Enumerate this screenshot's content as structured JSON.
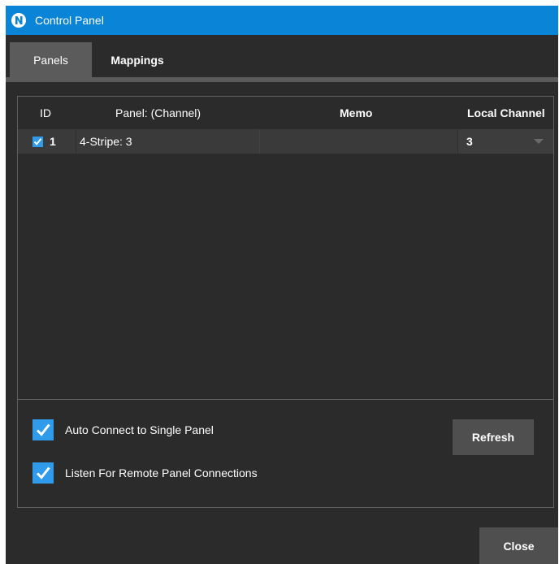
{
  "window": {
    "title": "Control Panel",
    "titlebar_color": "#0a84d6",
    "background_color": "#2b2b2b",
    "accent_color": "#2f9bea"
  },
  "tabs": [
    {
      "label": "Panels",
      "active": true
    },
    {
      "label": "Mappings",
      "active": false
    }
  ],
  "grid": {
    "columns": [
      "ID",
      "Panel: (Channel)",
      "Memo",
      "Local Channel"
    ],
    "rows": [
      {
        "checked": true,
        "id": "1",
        "panel": "4-Stripe: 3",
        "memo": "",
        "local_channel": "3"
      }
    ]
  },
  "options": {
    "auto_connect": {
      "label": "Auto Connect to Single Panel",
      "checked": true
    },
    "listen_remote": {
      "label": "Listen For Remote Panel Connections",
      "checked": true
    }
  },
  "buttons": {
    "refresh": "Refresh",
    "close": "Close"
  },
  "icons": {
    "app": "app-logo-icon",
    "check": "checkmark-icon",
    "dropdown": "chevron-down-icon"
  }
}
